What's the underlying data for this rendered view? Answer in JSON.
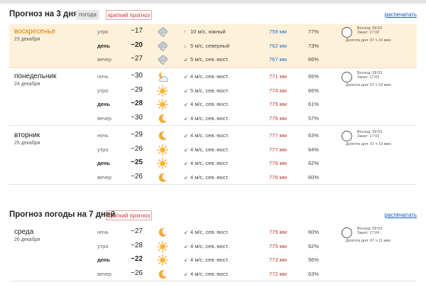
{
  "section3": {
    "title": "Прогноз на 3 дня",
    "tab_weather": "погода",
    "tab_brief": "краткий прогноз",
    "print": "распечатать"
  },
  "section7": {
    "title": "Прогноз погоды на 7 дней",
    "tab_brief": "краткий прогноз",
    "print": "распечатать"
  },
  "days": [
    {
      "name": "воскресенье",
      "date": "23 декабря",
      "sunrise": "Восход: 09:52",
      "sunset": "Закат: 17:02",
      "daylength": "Долгота дня: 07 ч 10 мин",
      "periods": [
        {
          "part": "утро",
          "temp": "−17",
          "icon": "cloud-snow-icon",
          "wind": "10 м/с, южный",
          "arrow": "↑",
          "pressure": "759 мм",
          "humidity": "77%"
        },
        {
          "part": "день",
          "temp": "−20",
          "icon": "cloud-snow-icon",
          "wind": "5 м/с, северный",
          "arrow": "↓",
          "pressure": "762 мм",
          "humidity": "73%"
        },
        {
          "part": "вечер",
          "temp": "−27",
          "icon": "cloud-snow-icon",
          "wind": "5 м/с, сев.-вост.",
          "arrow": "↙",
          "pressure": "767 мм",
          "humidity": "66%"
        }
      ]
    },
    {
      "name": "понедельник",
      "date": "24 декабря",
      "sunrise": "Восход: 09:53",
      "sunset": "Закат: 17:03",
      "daylength": "Долгота дня: 07 ч 10 мин",
      "periods": [
        {
          "part": "ночь",
          "temp": "−30",
          "icon": "moon-cloud-icon",
          "wind": "4 м/с, сев.-вост.",
          "arrow": "↙",
          "pressure": "771 мм",
          "humidity": "65%"
        },
        {
          "part": "утро",
          "temp": "−29",
          "icon": "sun-icon",
          "wind": "5 м/с, сев.-вост.",
          "arrow": "↙",
          "pressure": "774 мм",
          "humidity": "66%"
        },
        {
          "part": "день",
          "temp": "−28",
          "icon": "sun-icon",
          "wind": "4 м/с, сев.-вост.",
          "arrow": "↙",
          "pressure": "775 мм",
          "humidity": "61%"
        },
        {
          "part": "вечер",
          "temp": "−30",
          "icon": "moon-icon",
          "wind": "4 м/с, сев.-вост.",
          "arrow": "↙",
          "pressure": "776 мм",
          "humidity": "57%"
        }
      ]
    },
    {
      "name": "вторник",
      "date": "25 декабря",
      "sunrise": "Восход: 09:53",
      "sunset": "Закат: 17:03",
      "daylength": "Долгота дня: 07 ч 10 мин",
      "periods": [
        {
          "part": "ночь",
          "temp": "−29",
          "icon": "moon-icon",
          "wind": "4 м/с, сев.-вост.",
          "arrow": "↙",
          "pressure": "777 мм",
          "humidity": "63%"
        },
        {
          "part": "утро",
          "temp": "−26",
          "icon": "sun-icon",
          "wind": "4 м/с, сев.-вост.",
          "arrow": "↙",
          "pressure": "777 мм",
          "humidity": "64%"
        },
        {
          "part": "день",
          "temp": "−25",
          "icon": "sun-icon",
          "wind": "4 м/с, сев.-вост.",
          "arrow": "↙",
          "pressure": "776 мм",
          "humidity": "62%"
        },
        {
          "part": "вечер",
          "temp": "−26",
          "icon": "moon-icon",
          "wind": "4 м/с, сев.-вост.",
          "arrow": "↙",
          "pressure": "776 мм",
          "humidity": "60%"
        }
      ]
    },
    {
      "name": "среда",
      "date": "26 декабря",
      "sunrise": "Восход: 09:53",
      "sunset": "Закат: 17:04",
      "daylength": "Долгота дня: 07 ч 11 мин",
      "periods": [
        {
          "part": "ночь",
          "temp": "−27",
          "icon": "moon-icon",
          "wind": "4 м/с, сев.-вост.",
          "arrow": "↙",
          "pressure": "775 мм",
          "humidity": "60%"
        },
        {
          "part": "утро",
          "temp": "−28",
          "icon": "sun-icon",
          "wind": "4 м/с, сев.-вост.",
          "arrow": "↙",
          "pressure": "775 мм",
          "humidity": "62%"
        },
        {
          "part": "день",
          "temp": "−22",
          "icon": "sun-icon",
          "wind": "4 м/с, сев.-вост.",
          "arrow": "↙",
          "pressure": "773 мм",
          "humidity": "56%"
        },
        {
          "part": "вечер",
          "temp": "−26",
          "icon": "moon-icon",
          "wind": "4 м/с, сев.-вост.",
          "arrow": "↙",
          "pressure": "772 мм",
          "humidity": "63%"
        }
      ]
    }
  ]
}
